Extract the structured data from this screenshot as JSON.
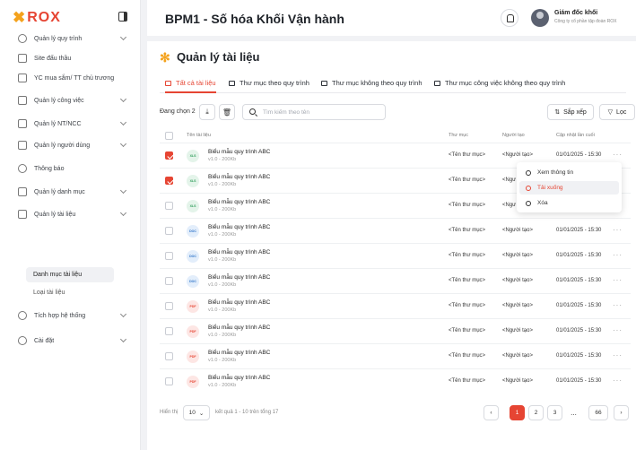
{
  "brand": {
    "logo": "ROX",
    "accent": "#e64533"
  },
  "sidebar": {
    "items": [
      {
        "label": "Quản lý quy trình",
        "icon": "gear-icon",
        "chev": true
      },
      {
        "label": "Site đấu thầu",
        "icon": "card-icon",
        "chev": false
      },
      {
        "label": "YC mua sắm/ TT chủ trương",
        "icon": "cart-icon",
        "chev": false
      },
      {
        "label": "Quản lý công việc",
        "icon": "briefcase-icon",
        "chev": true
      },
      {
        "label": "Quản lý NT/NCC",
        "icon": "truck-icon",
        "chev": true
      },
      {
        "label": "Quản lý người dùng",
        "icon": "users-icon",
        "chev": true
      },
      {
        "label": "Thông báo",
        "icon": "bell-icon",
        "chev": false
      },
      {
        "label": "Quản lý danh mục",
        "icon": "folder-icon",
        "chev": true
      },
      {
        "label": "Quản lý tài liệu",
        "icon": "document-icon",
        "chev": true
      }
    ],
    "sub_items": [
      {
        "label": "Danh mục tài liệu",
        "active": true
      },
      {
        "label": "Loại tài liệu",
        "active": false
      }
    ],
    "bottom_items": [
      {
        "label": "Tích hợp hệ thống",
        "icon": "integration-icon",
        "chev": true
      },
      {
        "label": "Cài đặt",
        "icon": "settings-icon",
        "chev": true
      }
    ]
  },
  "header": {
    "title": "BPM1 - Số hóa Khối Vận hành",
    "user_name": "Giám đốc khối",
    "user_org": "Công ty cổ phần tập đoàn ROX"
  },
  "page": {
    "title": "Quản lý tài liệu",
    "tabs": [
      {
        "label": "Tất cả tài liệu",
        "active": true
      },
      {
        "label": "Thư mục theo quy trình",
        "active": false
      },
      {
        "label": "Thư mục không theo quy trình",
        "active": false
      },
      {
        "label": "Thư mục công việc không theo quy trình",
        "active": false
      }
    ],
    "selected_label": "Đang chọn 2",
    "search_placeholder": "Tìm kiếm theo tên",
    "sort_label": "Sắp xếp",
    "filter_label": "Lọc"
  },
  "table": {
    "columns": [
      "Tên tài liệu",
      "Thư mục",
      "Người tạo",
      "Cập nhật lần cuối"
    ],
    "rows": [
      {
        "name": "Biểu mẫu quy trình ABC",
        "meta": "v1.0 - 200Kb",
        "type": "xls",
        "folder": "<Tên thư mục>",
        "creator": "<Người tạo>",
        "updated": "01/01/2025 - 15:30",
        "checked": true
      },
      {
        "name": "Biểu mẫu quy trình ABC",
        "meta": "v1.0 - 200Kb",
        "type": "xls",
        "folder": "<Tên thư mục>",
        "creator": "<Ngư",
        "updated": "",
        "checked": true
      },
      {
        "name": "Biểu mẫu quy trình ABC",
        "meta": "v1.0 - 200Kb",
        "type": "xls",
        "folder": "<Tên thư mục>",
        "creator": "<Ngư",
        "updated": "",
        "checked": false
      },
      {
        "name": "Biểu mẫu quy trình ABC",
        "meta": "v1.0 - 200Kb",
        "type": "doc",
        "folder": "<Tên thư mục>",
        "creator": "<Người tạo>",
        "updated": "01/01/2025 - 15:30",
        "checked": false
      },
      {
        "name": "Biểu mẫu quy trình ABC",
        "meta": "v1.0 - 200Kb",
        "type": "doc",
        "folder": "<Tên thư mục>",
        "creator": "<Người tạo>",
        "updated": "01/01/2025 - 15:30",
        "checked": false
      },
      {
        "name": "Biểu mẫu quy trình ABC",
        "meta": "v1.0 - 200Kb",
        "type": "doc",
        "folder": "<Tên thư mục>",
        "creator": "<Người tạo>",
        "updated": "01/01/2025 - 15:30",
        "checked": false
      },
      {
        "name": "Biểu mẫu quy trình ABC",
        "meta": "v1.0 - 200Kb",
        "type": "pdf",
        "folder": "<Tên thư mục>",
        "creator": "<Người tạo>",
        "updated": "01/01/2025 - 15:30",
        "checked": false
      },
      {
        "name": "Biểu mẫu quy trình ABC",
        "meta": "v1.0 - 200Kb",
        "type": "pdf",
        "folder": "<Tên thư mục>",
        "creator": "<Người tạo>",
        "updated": "01/01/2025 - 15:30",
        "checked": false
      },
      {
        "name": "Biểu mẫu quy trình ABC",
        "meta": "v1.0 - 200Kb",
        "type": "pdf",
        "folder": "<Tên thư mục>",
        "creator": "<Người tạo>",
        "updated": "01/01/2025 - 15:30",
        "checked": false
      },
      {
        "name": "Biểu mẫu quy trình ABC",
        "meta": "v1.0 - 200Kb",
        "type": "pdf",
        "folder": "<Tên thư mục>",
        "creator": "<Người tạo>",
        "updated": "01/01/2025 - 15:30",
        "checked": false
      }
    ]
  },
  "context_menu": [
    {
      "label": "Xem thông tin",
      "icon": "info-icon",
      "highlight": false
    },
    {
      "label": "Tải xuống",
      "icon": "download-icon",
      "highlight": true
    },
    {
      "label": "Xóa",
      "icon": "trash-icon",
      "highlight": false
    }
  ],
  "footer": {
    "show_label": "Hiển thị",
    "page_size": "10",
    "result_text": "kết quả 1 - 10 trên tổng 17",
    "pages": [
      "1",
      "2",
      "3",
      "...",
      "66"
    ],
    "current_page": "1"
  }
}
